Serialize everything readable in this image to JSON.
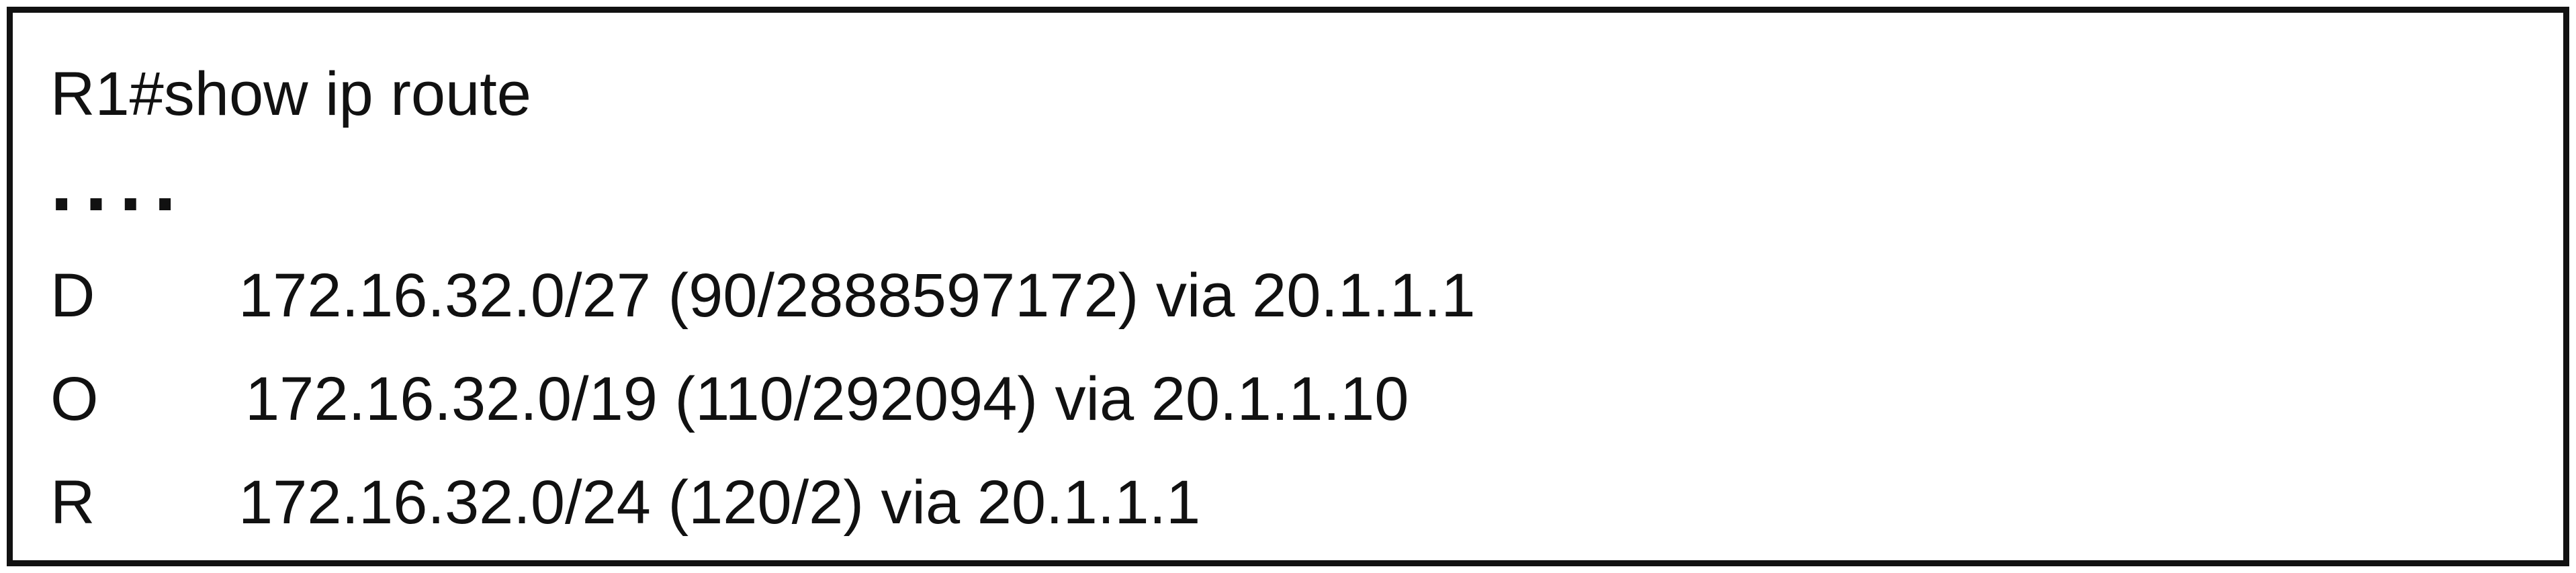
{
  "terminal": {
    "prompt": "R1#show ip route",
    "ellipsis": "....",
    "routes": [
      {
        "code": "D",
        "network": "172.16.32.0/27",
        "metric": "(90/2888597172)",
        "via": "via 20.1.1.1"
      },
      {
        "code": "O",
        "network": "172.16.32.0/19",
        "metric": "(110/292094)",
        "via": "via 20.1.1.10"
      },
      {
        "code": "R",
        "network": "172.16.32.0/24",
        "metric": "(120/2)",
        "via": "via 20.1.1.1"
      }
    ]
  }
}
